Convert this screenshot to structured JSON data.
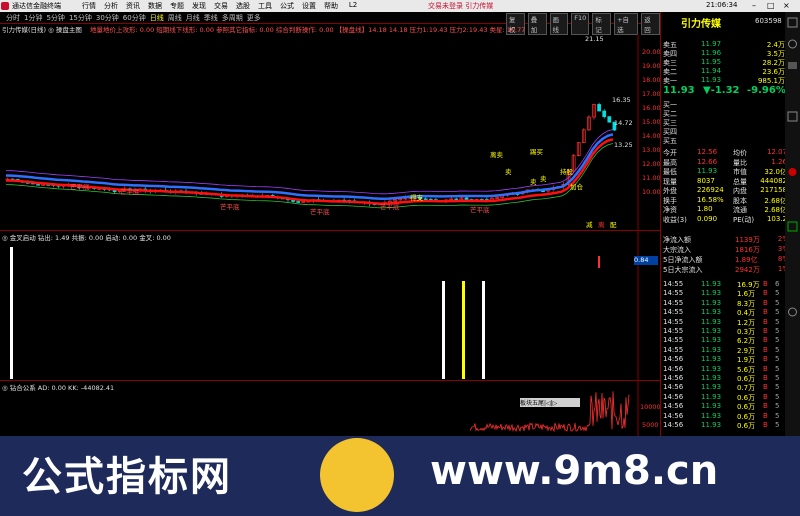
{
  "titlebar": {
    "app_name": "通达信金融终端",
    "menus": [
      "行情",
      "分析",
      "资讯",
      "数据",
      "专题",
      "发现",
      "交易",
      "选股",
      "工具",
      "公式",
      "设置",
      "帮助",
      "L2"
    ],
    "center_text": "交易未登录  引力传媒",
    "clock": "21:06:34"
  },
  "toolbar": {
    "periods": [
      "分时",
      "1分钟",
      "5分钟",
      "15分钟",
      "30分钟",
      "60分钟",
      "日线",
      "周线",
      "月线",
      "季线",
      "多周期",
      "更多"
    ],
    "active_period": "日线",
    "right_buttons": [
      "复权",
      "叠加",
      "画线",
      "F10",
      "标记",
      "+自选",
      "返回"
    ]
  },
  "main": {
    "header": "引力传媒(日线)  ◎  操盘主图",
    "header2": "地量地价上攻形: 0.00  短期线下线形: 0.00  参照其它指标: 0.00  综合判断操作: 0.00  【操盘线】14.18  14.18  压力1:19.43  压力2:19.43  类星: 10.77",
    "price_axis": [
      "20.00",
      "19.00",
      "18.00",
      "17.00",
      "16.00",
      "15.00",
      "14.00",
      "13.00",
      "12.00",
      "11.00",
      "10.00"
    ],
    "high_label": "21.15",
    "label_1635": "16.35",
    "label_1472": "14.72",
    "label_1325": "13.25",
    "annotations": [
      "芒平底",
      "芒平底",
      "芒平底",
      "芒平底",
      "芒平底",
      "芒平底",
      "得支",
      "持股",
      "离卖",
      "踢买",
      "加仓",
      "卖",
      "卖",
      "卖"
    ],
    "bottom_tags": [
      "减",
      "离",
      "配"
    ]
  },
  "sub1": {
    "header": "◎  金叉启动  钻出: 1.49  共振: 0.00  启动: 0.00  金叉: 0.00",
    "axis_label": "0.84"
  },
  "sub2": {
    "header": "◎  钻合公系  AD: 0.00  KK: -44082.41",
    "axis": [
      "10000",
      "5000"
    ],
    "mini_panel": "板块五尾|◁|▷"
  },
  "quote": {
    "stock_name": "引力传媒",
    "code": "603598",
    "price": "11.93",
    "change": "▼-1.32",
    "pct": "-9.96%",
    "asks": [
      {
        "label": "卖五",
        "price": "11.97",
        "vol": "2.4万"
      },
      {
        "label": "卖四",
        "price": "11.96",
        "vol": "3.5万"
      },
      {
        "label": "卖三",
        "price": "11.95",
        "vol": "28.2万"
      },
      {
        "label": "卖二",
        "price": "11.94",
        "vol": "23.6万"
      },
      {
        "label": "卖一",
        "price": "11.93",
        "vol": "985.1万"
      }
    ],
    "bids": [
      {
        "label": "买一",
        "price": "",
        "vol": ""
      },
      {
        "label": "买二",
        "price": "",
        "vol": ""
      },
      {
        "label": "买三",
        "price": "",
        "vol": ""
      },
      {
        "label": "买四",
        "price": "",
        "vol": ""
      },
      {
        "label": "买五",
        "price": "",
        "vol": ""
      }
    ],
    "stats": [
      {
        "l1": "今开",
        "v1": "12.56",
        "l2": "均价",
        "v2": "12.07"
      },
      {
        "l1": "最高",
        "v1": "12.66",
        "l2": "量比",
        "v2": "1.26"
      },
      {
        "l1": "最低",
        "v1": "11.93",
        "l2": "市值",
        "v2": "32.0亿"
      },
      {
        "l1": "现量",
        "v1": "8037",
        "l2": "总量",
        "v2": "444082"
      },
      {
        "l1": "外盘",
        "v1": "226924",
        "l2": "内盘",
        "v2": "217158"
      },
      {
        "l1": "换手",
        "v1": "16.58%",
        "l2": "股本",
        "v2": "2.68亿"
      },
      {
        "l1": "净资",
        "v1": "1.80",
        "l2": "流通",
        "v2": "2.68亿"
      },
      {
        "l1": "收益(3)",
        "v1": "0.090",
        "l2": "PE(动)",
        "v2": "103.2"
      }
    ],
    "flows": [
      {
        "label": "净流入额",
        "val": "1139万",
        "pct": "2%"
      },
      {
        "label": "大宗流入",
        "val": "1816万",
        "pct": "3%"
      },
      {
        "label": "5日净流入额",
        "val": "1.89亿",
        "pct": "8%"
      },
      {
        "label": "5日大宗流入",
        "val": "2942万",
        "pct": "1%"
      }
    ],
    "ticks": [
      {
        "t": "14:55",
        "p": "11.93",
        "v": "16.9万",
        "s": "B",
        "n": "6"
      },
      {
        "t": "14:55",
        "p": "11.93",
        "v": "1.6万",
        "s": "B",
        "n": "5"
      },
      {
        "t": "14:55",
        "p": "11.93",
        "v": "8.3万",
        "s": "B",
        "n": "5"
      },
      {
        "t": "14:55",
        "p": "11.93",
        "v": "0.4万",
        "s": "B",
        "n": "5"
      },
      {
        "t": "14:55",
        "p": "11.93",
        "v": "1.2万",
        "s": "B",
        "n": "5"
      },
      {
        "t": "14:55",
        "p": "11.93",
        "v": "0.3万",
        "s": "B",
        "n": "5"
      },
      {
        "t": "14:55",
        "p": "11.93",
        "v": "6.2万",
        "s": "B",
        "n": "5"
      },
      {
        "t": "14:55",
        "p": "11.93",
        "v": "2.9万",
        "s": "B",
        "n": "5"
      },
      {
        "t": "14:56",
        "p": "11.93",
        "v": "1.9万",
        "s": "B",
        "n": "5"
      },
      {
        "t": "14:56",
        "p": "11.93",
        "v": "5.6万",
        "s": "B",
        "n": "5"
      },
      {
        "t": "14:56",
        "p": "11.93",
        "v": "0.6万",
        "s": "B",
        "n": "5"
      },
      {
        "t": "14:56",
        "p": "11.93",
        "v": "0.7万",
        "s": "B",
        "n": "5"
      },
      {
        "t": "14:56",
        "p": "11.93",
        "v": "0.6万",
        "s": "B",
        "n": "5"
      },
      {
        "t": "14:56",
        "p": "11.93",
        "v": "0.6万",
        "s": "B",
        "n": "5"
      },
      {
        "t": "14:56",
        "p": "11.93",
        "v": "0.6万",
        "s": "B",
        "n": "5"
      },
      {
        "t": "14:56",
        "p": "11.93",
        "v": "0.6万",
        "s": "B",
        "n": "5"
      }
    ]
  },
  "watermark": {
    "cn_text": "公式指标网",
    "url": "www.9m8.cn"
  },
  "colors": {
    "up": "#ff3030",
    "down": "#00d060",
    "accent": "#ffff00",
    "bg": "#000000"
  }
}
